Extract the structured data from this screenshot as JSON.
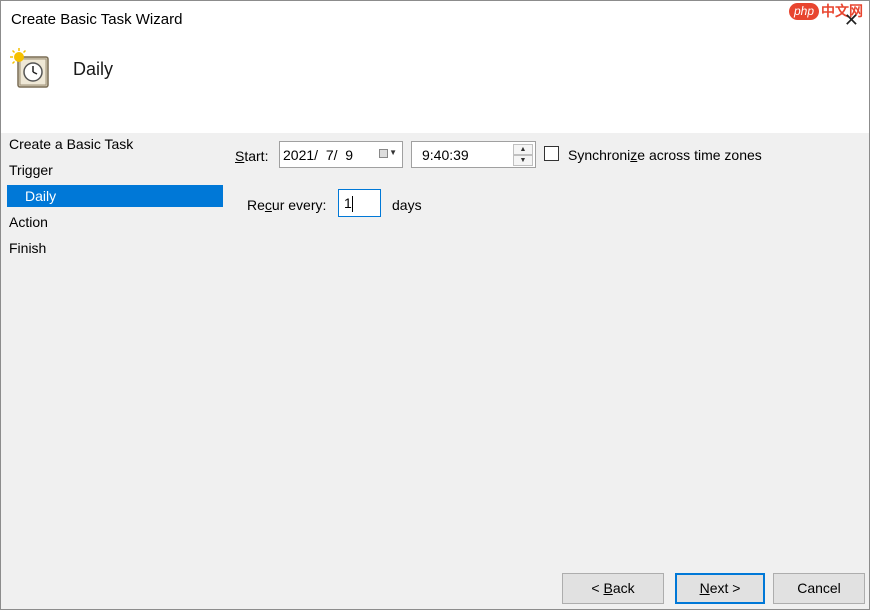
{
  "window": {
    "title": "Create Basic Task Wizard",
    "close_glyph": "✕"
  },
  "watermark": {
    "badge": "php",
    "site": "中文网"
  },
  "header": {
    "title": "Daily",
    "icon": "clock-icon"
  },
  "nav": {
    "items": [
      {
        "label": "Create a Basic Task"
      },
      {
        "label": "Trigger"
      },
      {
        "label": "Daily"
      },
      {
        "label": "Action"
      },
      {
        "label": "Finish"
      }
    ]
  },
  "form": {
    "start_label_pre": "",
    "start_label_u": "S",
    "start_label_post": "tart:",
    "date_value": "2021/  7/  9",
    "time_value": "9:40:39",
    "sync_pre": "Synchroni",
    "sync_u": "z",
    "sync_post": "e across time zones",
    "sync_checked": false,
    "recur_pre": "Re",
    "recur_u": "c",
    "recur_post": "ur every:",
    "recur_value": "1",
    "recur_unit": "days"
  },
  "buttons": {
    "back_pre": "< ",
    "back_u": "B",
    "back_post": "ack",
    "next_u": "N",
    "next_post": "ext >",
    "cancel": "Cancel"
  }
}
